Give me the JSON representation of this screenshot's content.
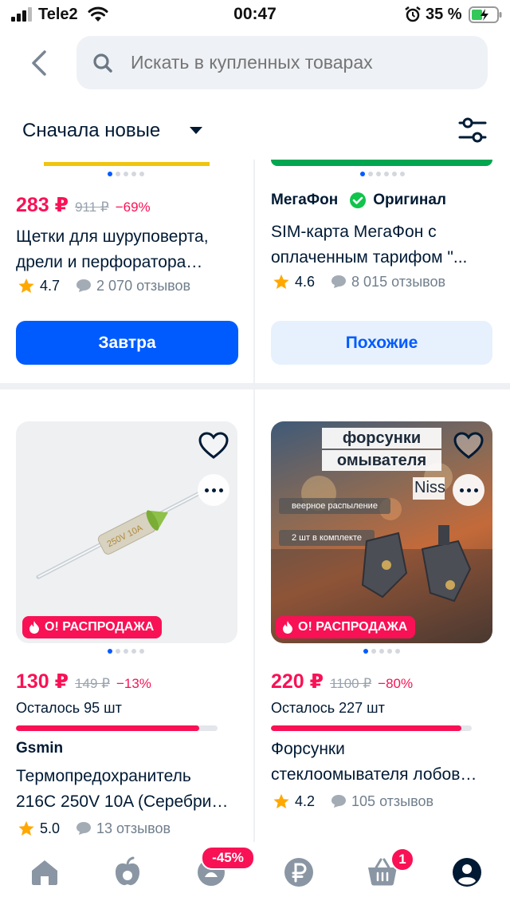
{
  "status": {
    "carrier": "Tele2",
    "time": "00:47",
    "battery": "35 %"
  },
  "header": {
    "search_placeholder": "Искать в купленных товарах"
  },
  "sort": {
    "label": "Сначала новые"
  },
  "products": [
    {
      "price": "283 ₽",
      "old_price": "911 ₽",
      "discount": "−69%",
      "title_line1": "Щетки для шуруповерта,",
      "title_line2": "дрели и перфоратора…",
      "rating": "4.7",
      "reviews": "2 070 отзывов",
      "button": "Завтра",
      "strip_color": "#f1c40f"
    },
    {
      "brand": "МегаФон",
      "badge": "Оригинал",
      "title_line1": "SIM-карта МегаФон с",
      "title_line2": "оплаченным тарифом \"...",
      "rating": "4.6",
      "reviews": "8 015 отзывов",
      "button": "Похожие",
      "strip_color": "#00a650"
    },
    {
      "sale": "О! РАСПРОДАЖА",
      "image_text": "250V 10A",
      "price": "130 ₽",
      "old_price": "149 ₽",
      "discount": "−13%",
      "remaining": "Осталось 95 шт",
      "remaining_fraction": 0.91,
      "brand": "Gsmin",
      "title_line1": "Термопредохранитель",
      "title_line2": "216C 250V 10A (Серебри…",
      "rating": "5.0",
      "reviews": "13 отзывов"
    },
    {
      "sale": "О! РАСПРОДАЖА",
      "image_title_1": "форсунки",
      "image_title_2": "омывателя",
      "image_note_1": "веерное распыление",
      "image_note_2": "2 шт в комплекте",
      "image_brand": "Niss",
      "price": "220 ₽",
      "old_price": "1100 ₽",
      "discount": "−80%",
      "remaining": "Осталось 227 шт",
      "remaining_fraction": 0.95,
      "title_line1": "Форсунки",
      "title_line2": "стеклоомывателя лобов…",
      "rating": "4.2",
      "reviews": "105 отзывов"
    }
  ],
  "tabbar": {
    "promo_badge": "-45%",
    "cart_count": "1"
  },
  "colors": {
    "accent": "#005bff",
    "sale": "#f91155"
  }
}
